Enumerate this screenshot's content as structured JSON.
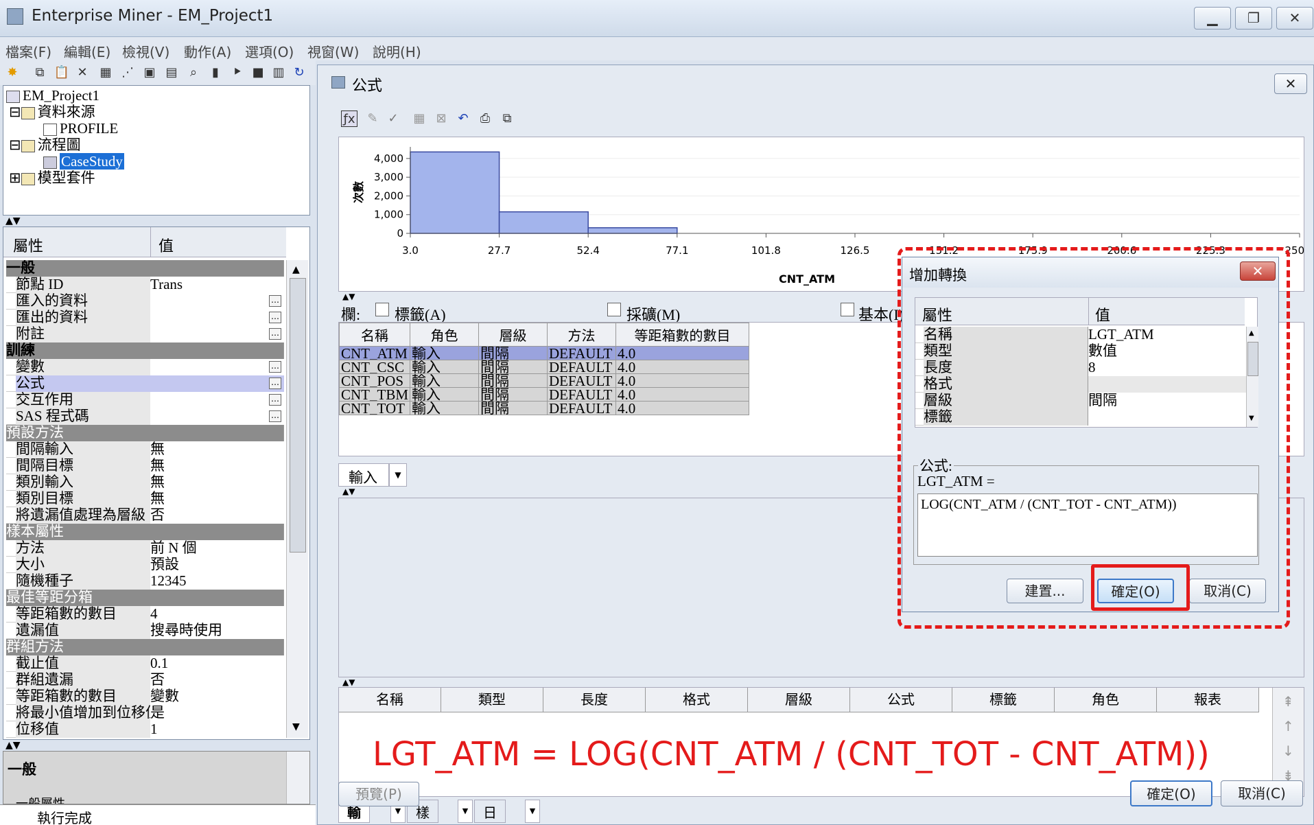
{
  "app": {
    "title": "Enterprise Miner - EM_Project1"
  },
  "menu": [
    "檔案(F)",
    "編輯(E)",
    "檢視(V)",
    "動作(A)",
    "選項(O)",
    "視窗(W)",
    "說明(H)"
  ],
  "tree": {
    "root": "EM_Project1",
    "items": [
      {
        "label": "資料來源",
        "indent": 1
      },
      {
        "label": "PROFILE",
        "indent": 2
      },
      {
        "label": "流程圖",
        "indent": 1
      },
      {
        "label": "CaseStudy",
        "indent": 2
      },
      {
        "label": "模型套件",
        "indent": 1
      }
    ]
  },
  "props": {
    "col_attr": "屬性",
    "col_val": "值",
    "rows": [
      {
        "k": "一般",
        "v": "",
        "type": "sec"
      },
      {
        "k": "節點 ID",
        "v": "Trans"
      },
      {
        "k": "匯入的資料",
        "v": "",
        "ell": true
      },
      {
        "k": "匯出的資料",
        "v": "",
        "ell": true
      },
      {
        "k": "附註",
        "v": "",
        "ell": true
      },
      {
        "k": "訓練",
        "v": "",
        "type": "sec"
      },
      {
        "k": "變數",
        "v": "",
        "ell": true
      },
      {
        "k": "公式",
        "v": "",
        "ell": true,
        "sel": true
      },
      {
        "k": "交互作用",
        "v": "",
        "ell": true
      },
      {
        "k": "SAS 程式碼",
        "v": "",
        "ell": true
      },
      {
        "k": "預設方法",
        "v": "",
        "type": "sec2"
      },
      {
        "k": "間隔輸入",
        "v": "無"
      },
      {
        "k": "間隔目標",
        "v": "無"
      },
      {
        "k": "類別輸入",
        "v": "無"
      },
      {
        "k": "類別目標",
        "v": "無"
      },
      {
        "k": "將遺漏值處理為層級",
        "v": "否"
      },
      {
        "k": "樣本屬性",
        "v": "",
        "type": "sec2"
      },
      {
        "k": "方法",
        "v": "前 N 個"
      },
      {
        "k": "大小",
        "v": "預設"
      },
      {
        "k": "隨機種子",
        "v": "12345"
      },
      {
        "k": "最佳等距分箱",
        "v": "",
        "type": "sec2"
      },
      {
        "k": "等距箱數的數目",
        "v": "4"
      },
      {
        "k": "遺漏值",
        "v": "搜尋時使用"
      },
      {
        "k": "群組方法",
        "v": "",
        "type": "sec2"
      },
      {
        "k": "截止值",
        "v": "0.1"
      },
      {
        "k": "群組遺漏",
        "v": "否"
      },
      {
        "k": "等距箱數的數目",
        "v": "變數"
      },
      {
        "k": "將最小值增加到位移值",
        "v": "是"
      },
      {
        "k": "位移值",
        "v": "1"
      }
    ],
    "bottom_label": "一般",
    "bottom_label2": "一般屬性"
  },
  "status": "執行完成",
  "formula_window": {
    "title": "公式",
    "chart_ylabel": "次數",
    "chart_xlabel": "CNT_ATM",
    "columns_label": "欄:",
    "check_label": "標籤(A)",
    "check_mining": "採礦(M)",
    "check_basic": "基本(I)",
    "table_headers": [
      "名稱",
      "角色",
      "層級",
      "方法",
      "等距箱數的數目"
    ],
    "table_rows": [
      [
        "CNT_ATM",
        "輸入",
        "間隔",
        "DEFAULT",
        "4.0"
      ],
      [
        "CNT_CSC",
        "輸入",
        "間隔",
        "DEFAULT",
        "4.0"
      ],
      [
        "CNT_POS",
        "輸入",
        "間隔",
        "DEFAULT",
        "4.0"
      ],
      [
        "CNT_TBM",
        "輸入",
        "間隔",
        "DEFAULT",
        "4.0"
      ],
      [
        "CNT_TOT",
        "輸入",
        "間隔",
        "DEFAULT",
        "4.0"
      ]
    ],
    "input_tab": "輸入",
    "output_headers": [
      "名稱",
      "類型",
      "長度",
      "格式",
      "層級",
      "公式",
      "標籤",
      "角色",
      "報表"
    ],
    "output_tabs": [
      "輸出",
      "樣本",
      "日誌"
    ],
    "preview_button": "預覽(P)",
    "ok_button": "確定(O)",
    "cancel_button": "取消(C)",
    "annotation": "LGT_ATM = LOG(CNT_ATM / (CNT_TOT - CNT_ATM))"
  },
  "chart_data": {
    "type": "bar",
    "xlabel": "CNT_ATM",
    "ylabel": "次數",
    "x_ticks": [
      "3.0",
      "27.7",
      "52.4",
      "77.1",
      "101.8",
      "126.5",
      "151.2",
      "175.9",
      "200.6",
      "225.3",
      "250.0"
    ],
    "y_ticks": [
      "0",
      "1,000",
      "2,000",
      "3,000",
      "4,000"
    ],
    "ylim": [
      0,
      4400
    ],
    "bins": [
      {
        "from": 3.0,
        "to": 27.7,
        "value": 4350
      },
      {
        "from": 27.7,
        "to": 52.4,
        "value": 1150
      },
      {
        "from": 52.4,
        "to": 77.1,
        "value": 300
      },
      {
        "from": 77.1,
        "to": 250.0,
        "value": 0
      }
    ]
  },
  "dialog": {
    "title": "增加轉換",
    "col_attr": "屬性",
    "col_val": "值",
    "rows": [
      {
        "k": "名稱",
        "v": "LGT_ATM"
      },
      {
        "k": "類型",
        "v": "數值"
      },
      {
        "k": "長度",
        "v": "8"
      },
      {
        "k": "格式",
        "v": ""
      },
      {
        "k": "層級",
        "v": "間隔"
      },
      {
        "k": "標籤",
        "v": ""
      }
    ],
    "formula_label": "公式:",
    "formula_lhs": "LGT_ATM =",
    "formula_value": "LOG(CNT_ATM / (CNT_TOT - CNT_ATM))",
    "build_button": "建置...",
    "ok_button": "確定(O)",
    "cancel_button": "取消(C)"
  }
}
